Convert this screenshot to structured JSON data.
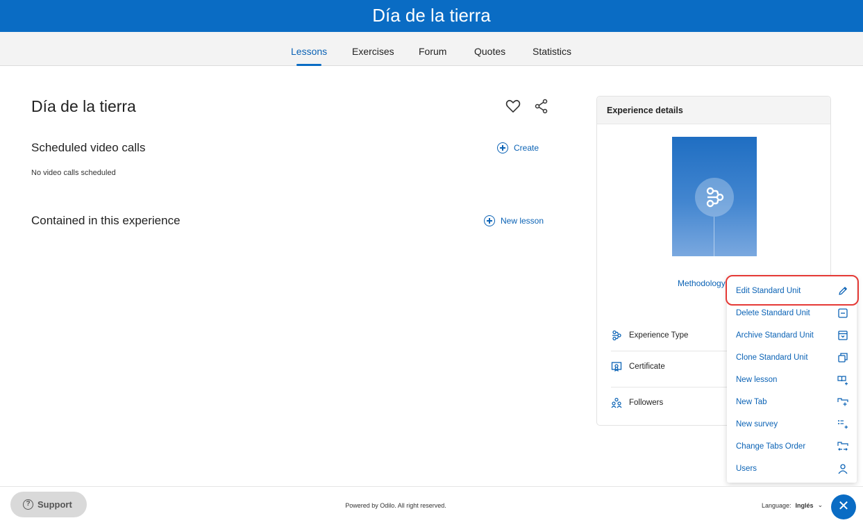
{
  "header": {
    "title": "Día de la tierra"
  },
  "tabs": [
    {
      "label": "Lessons",
      "active": true
    },
    {
      "label": "Exercises",
      "active": false
    },
    {
      "label": "Forum",
      "active": false
    },
    {
      "label": "Quotes",
      "active": false
    },
    {
      "label": "Statistics",
      "active": false
    }
  ],
  "main": {
    "title": "Día de la tierra",
    "video_calls": {
      "title": "Scheduled video calls",
      "empty_text": "No video calls scheduled",
      "create_label": "Create"
    },
    "contained": {
      "title": "Contained in this experience",
      "new_lesson_label": "New lesson"
    }
  },
  "panel": {
    "title": "Experience details",
    "methodology_label": "Methodology",
    "rows": [
      {
        "label": "Experience Type",
        "icon": "experience-type-icon"
      },
      {
        "label": "Certificate",
        "icon": "certificate-icon"
      },
      {
        "label": "Followers",
        "icon": "followers-icon"
      }
    ]
  },
  "menu": {
    "items": [
      {
        "label": "Edit Standard Unit",
        "icon": "pencil-icon",
        "highlighted": true
      },
      {
        "label": "Delete Standard Unit",
        "icon": "delete-icon"
      },
      {
        "label": "Archive Standard Unit",
        "icon": "archive-icon"
      },
      {
        "label": "Clone Standard Unit",
        "icon": "clone-icon"
      },
      {
        "label": "New lesson",
        "icon": "new-lesson-icon"
      },
      {
        "label": "New Tab",
        "icon": "new-tab-icon"
      },
      {
        "label": "New survey",
        "icon": "new-survey-icon"
      },
      {
        "label": "Change Tabs Order",
        "icon": "reorder-tabs-icon"
      },
      {
        "label": "Users",
        "icon": "user-icon"
      }
    ]
  },
  "footer": {
    "support_label": "Support",
    "powered_text": "Powered by Odilo. All right reserved.",
    "language_label": "Language:",
    "language_value": "Inglés"
  },
  "colors": {
    "brand": "#0a6cc4",
    "link": "#0a62b5",
    "highlight": "#e53935"
  }
}
